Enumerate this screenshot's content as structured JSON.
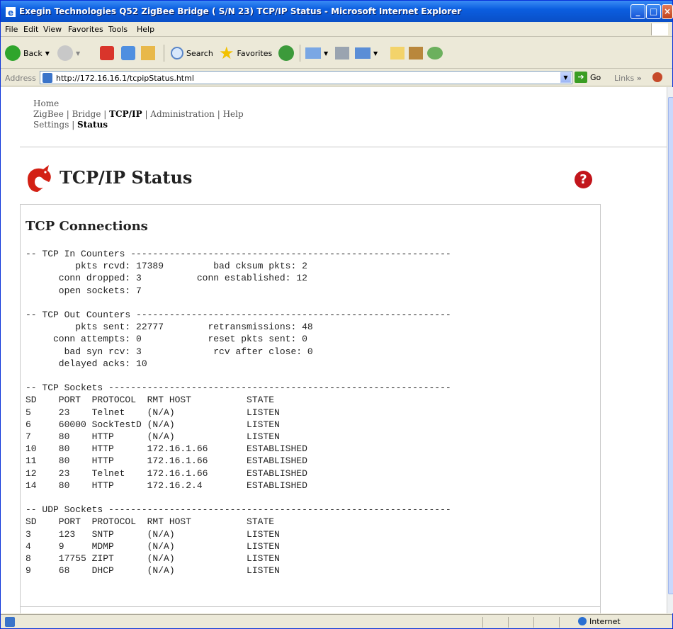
{
  "window": {
    "title": "Exegin Technologies Q52 ZigBee Bridge ( S/N 23) TCP/IP Status - Microsoft Internet Explorer"
  },
  "menu": [
    "File",
    "Edit",
    "View",
    "Favorites",
    "Tools",
    "Help"
  ],
  "toolbar": {
    "back": "Back",
    "search": "Search",
    "favorites": "Favorites"
  },
  "address": {
    "label": "Address",
    "url": "http://172.16.16.1/tcpipStatus.html",
    "go": "Go",
    "links": "Links"
  },
  "status": {
    "zone": "Internet"
  },
  "nav": {
    "home": "Home",
    "zigbee": "ZigBee",
    "bridge": "Bridge",
    "tcpip": "TCP/IP",
    "administration": "Administration",
    "help": "Help",
    "settings": "Settings",
    "status": "Status"
  },
  "page": {
    "title": "TCP/IP Status",
    "section": "TCP Connections",
    "help_icon": "?"
  },
  "counters": [
    {
      "header": "-- TCP In Counters ----------------------------------------------------------",
      "lines": [
        "         pkts rcvd: 17389         bad cksum pkts: 2",
        "      conn dropped: 3          conn established: 12",
        "      open sockets: 7"
      ]
    },
    {
      "header": "-- TCP Out Counters ---------------------------------------------------------",
      "lines": [
        "         pkts sent: 22777        retransmissions: 48",
        "     conn attempts: 0            reset pkts sent: 0",
        "       bad syn rcv: 3             rcv after close: 0",
        "      delayed acks: 10"
      ]
    }
  ],
  "tcp_sockets": {
    "header": "-- TCP Sockets --------------------------------------------------------------",
    "columns": [
      "SD",
      "PORT",
      "PROTOCOL",
      "RMT HOST",
      "STATE"
    ],
    "rows": [
      [
        "5",
        "23",
        "Telnet",
        "(N/A)",
        "LISTEN"
      ],
      [
        "6",
        "60000",
        "SockTestD",
        "(N/A)",
        "LISTEN"
      ],
      [
        "7",
        "80",
        "HTTP",
        "(N/A)",
        "LISTEN"
      ],
      [
        "10",
        "80",
        "HTTP",
        "172.16.1.66",
        "ESTABLISHED"
      ],
      [
        "11",
        "80",
        "HTTP",
        "172.16.1.66",
        "ESTABLISHED"
      ],
      [
        "12",
        "23",
        "Telnet",
        "172.16.1.66",
        "ESTABLISHED"
      ],
      [
        "14",
        "80",
        "HTTP",
        "172.16.2.4",
        "ESTABLISHED"
      ]
    ]
  },
  "udp_sockets": {
    "header": "-- UDP Sockets --------------------------------------------------------------",
    "columns": [
      "SD",
      "PORT",
      "PROTOCOL",
      "RMT HOST",
      "STATE"
    ],
    "rows": [
      [
        "3",
        "123",
        "SNTP",
        "(N/A)",
        "LISTEN"
      ],
      [
        "4",
        "9",
        "MDMP",
        "(N/A)",
        "LISTEN"
      ],
      [
        "8",
        "17755",
        "ZIPT",
        "(N/A)",
        "LISTEN"
      ],
      [
        "9",
        "68",
        "DHCP",
        "(N/A)",
        "LISTEN"
      ]
    ]
  }
}
